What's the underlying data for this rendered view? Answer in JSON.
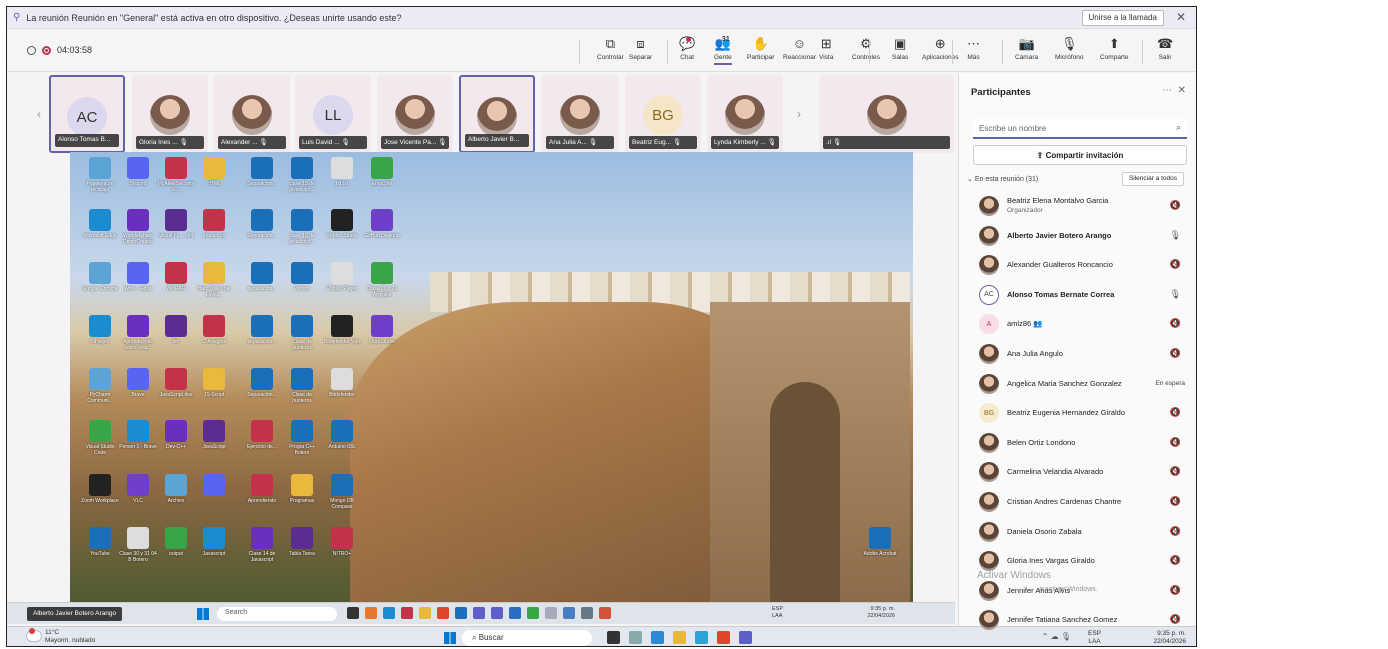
{
  "notification": {
    "text": "La reunión Reunión en \"General\" está activa en otro dispositivo. ¿Deseas unirte usando este?",
    "join_label": "Unirse a la llamada",
    "close_glyph": "✕"
  },
  "meeting": {
    "timer": "04:03:58",
    "buttons": [
      {
        "label": "Controlar",
        "icon": "⧉"
      },
      {
        "label": "Separar",
        "icon": "⧈"
      },
      {
        "label": "Chat",
        "icon": "💬"
      },
      {
        "label": "Gente",
        "icon": "👥",
        "badge": "31"
      },
      {
        "label": "Participar",
        "icon": "✋"
      },
      {
        "label": "Reaccionar",
        "icon": "☺"
      },
      {
        "label": "Vista",
        "icon": "⊞"
      },
      {
        "label": "Controles",
        "icon": "⚙"
      },
      {
        "label": "Salas",
        "icon": "▣"
      },
      {
        "label": "Aplicaciones",
        "icon": "⊕"
      },
      {
        "label": "Más",
        "icon": "⋯"
      },
      {
        "label": "Cámara",
        "icon": "📷"
      },
      {
        "label": "Micrófono",
        "icon": "🎙"
      },
      {
        "label": "Comparte",
        "icon": "⬆"
      },
      {
        "label": "Salir",
        "icon": "☎"
      }
    ]
  },
  "tiles": [
    {
      "initials": "AC",
      "name": "Alonso Tomas B...",
      "type": "init"
    },
    {
      "initials": "",
      "name": "Gloria Ines ...",
      "type": "ph"
    },
    {
      "initials": "",
      "name": "Alexander ...",
      "type": "ph"
    },
    {
      "initials": "LL",
      "name": "Luis David ...",
      "type": "init"
    },
    {
      "initials": "",
      "name": "Jose Vicente Pa...",
      "type": "ph"
    },
    {
      "initials": "",
      "name": "Alberto Javier B...",
      "type": "ph"
    },
    {
      "initials": "",
      "name": "Ana Julia A...",
      "type": "ph"
    },
    {
      "initials": "BG",
      "name": "Beatriz Eug...",
      "type": "bg"
    },
    {
      "initials": "",
      "name": "Lynda Kimberly ...",
      "type": "ph"
    },
    {
      "initials": "",
      "name": ".ıl",
      "type": "ph"
    }
  ],
  "desktop": {
    "icons": [
      "Papelera de reciclaje",
      "Discord",
      "McAfee Security Sc...",
      "HTML",
      "Separación...",
      "clase 15 de javascript...",
      "txt.txt",
      "EnsaSfer",
      "Microsoft Edge",
      "Wondershare DemoCreator",
      "Visual FL... x64",
      "imagen.dl",
      "Separación...",
      "clase 16 de javascript...",
      "Roblox Studio",
      "GitHub Desktop",
      "Google Chrome",
      "Work - Edge",
      "WinRAR",
      "Hard Disk Low Level...",
      "separación...",
      "Python",
      "Roblox Player",
      "Clase 20 y 21 Arreglos",
      "StHelper",
      "Aprende más sobre esta...",
      "bin",
      "C-Arreglos",
      "separación...",
      "Clase de punteros",
      "Bitdefender Vpn",
      "LibreStudio",
      "PyCharm Communi...",
      "Brave",
      "JavaScript.dev",
      "JS-Script",
      "Separación...",
      "Clase de punteros",
      "Bitdefender",
      "Visual Studio Code",
      "Person 1 - Brave",
      "Dev-C++",
      "JavaScript",
      "Ejercicio de...",
      "Progra C++ Botero",
      "Arduino IDE",
      "Zoom Workplace",
      "VLC",
      "Archivo",
      "",
      "Aprendiendo",
      "Programas",
      "Mongo DB Compass",
      "YouTube",
      "Clase 30 y 31 04 B Botero",
      "output",
      "Javascript",
      "Clase 14 de Javascript",
      "Tabla Tarea",
      "NITRO+",
      "Adobe Acrobat"
    ],
    "taskbar_name": "Alberto Javier Botero Arango",
    "search": "Search",
    "lang": "ESP\nLAA",
    "time": "9:35 p. m.",
    "date": "22/04/2026"
  },
  "taskbar": {
    "temp": "11°C",
    "weather": "Mayorm. nublado",
    "search": "Buscar",
    "lang1": "ESP",
    "lang2": "LAA",
    "time": "9:35 p. m.",
    "date": "22/04/2026"
  },
  "panel": {
    "title": "Participantes",
    "search_placeholder": "Escribe un nombre",
    "share_label": "Compartir invitación",
    "section_label": "En esta reunión (31)",
    "mute_all_label": "Silenciar a todos",
    "participants": [
      {
        "name": "Beatriz Elena Montalvo Garcia",
        "role": "Organizador",
        "avatar": "ph",
        "initials": "",
        "bold": false,
        "status": "mic-off"
      },
      {
        "name": "Alberto Javier Botero Arango",
        "role": "",
        "avatar": "ph",
        "initials": "",
        "bold": true,
        "status": "mic-on"
      },
      {
        "name": "Alexander Gualteros Roncancio",
        "role": "",
        "avatar": "ph",
        "initials": "",
        "bold": false,
        "status": "mic-off"
      },
      {
        "name": "Alonso Tomas Bernate Correa",
        "role": "",
        "avatar": "init",
        "initials": "AC",
        "bold": true,
        "status": "mic-on"
      },
      {
        "name": "amlz86 👥",
        "role": "",
        "avatar": "pink",
        "initials": "A",
        "bold": false,
        "status": "mic-off"
      },
      {
        "name": "Ana Julia Angulo",
        "role": "",
        "avatar": "ph",
        "initials": "",
        "bold": false,
        "status": "mic-off"
      },
      {
        "name": "Angelica Maria Sanchez Gonzalez",
        "role": "",
        "avatar": "ph",
        "initials": "",
        "bold": false,
        "status": "En espera"
      },
      {
        "name": "Beatriz Eugenia Hernandez Giraldo",
        "role": "",
        "avatar": "bg",
        "initials": "BG",
        "bold": false,
        "status": "mic-off"
      },
      {
        "name": "Belen Ortiz Londono",
        "role": "",
        "avatar": "ph",
        "initials": "",
        "bold": false,
        "status": "mic-off"
      },
      {
        "name": "Carmelina Velandia Alvarado",
        "role": "",
        "avatar": "ph",
        "initials": "",
        "bold": false,
        "status": "mic-off"
      },
      {
        "name": "Cristian Andres Cardenas Chantre",
        "role": "",
        "avatar": "ph",
        "initials": "",
        "bold": false,
        "status": "mic-off"
      },
      {
        "name": "Daniela Osorio Zabala",
        "role": "",
        "avatar": "ph",
        "initials": "",
        "bold": false,
        "status": "mic-off"
      },
      {
        "name": "Gloria Ines Vargas Giraldo",
        "role": "",
        "avatar": "ph",
        "initials": "",
        "bold": false,
        "status": "mic-off"
      },
      {
        "name": "Jennifer Arias Alvis",
        "role": "",
        "avatar": "ph",
        "initials": "",
        "bold": false,
        "status": "mic-off"
      },
      {
        "name": "Jennifer Tatiana Sanchez Gomez",
        "role": "",
        "avatar": "ph",
        "initials": "",
        "bold": false,
        "status": "mic-off"
      }
    ]
  },
  "watermark": {
    "line1": "Activar Windows",
    "line2": "a activar Windows."
  }
}
